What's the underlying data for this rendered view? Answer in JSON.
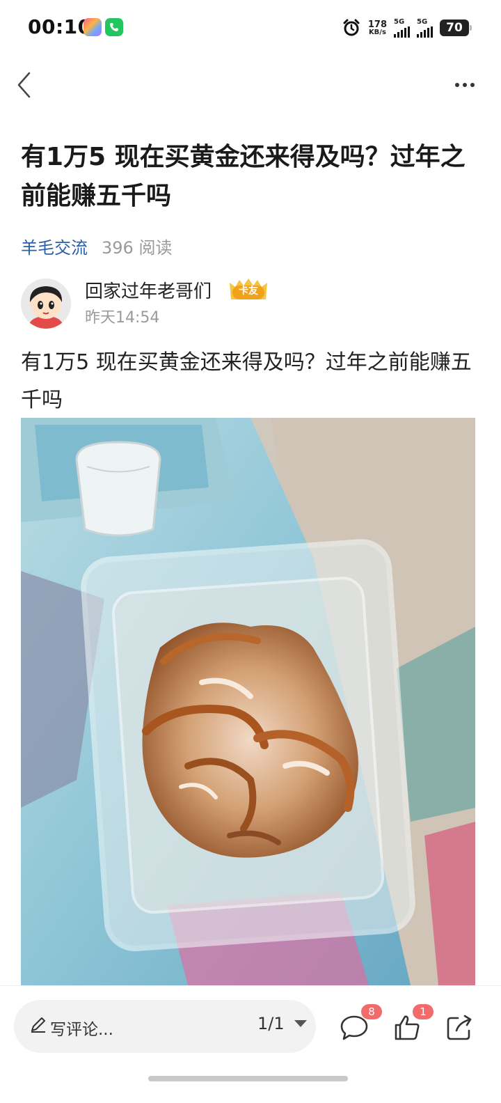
{
  "status_bar": {
    "time": "00:10",
    "net_speed_value": "178",
    "net_speed_unit": "KB/s",
    "signal1_label": "5G",
    "signal2_label": "5G",
    "battery": "70"
  },
  "post": {
    "title": "有1万5 现在买黄金还来得及吗？过年之前能赚五千吗",
    "section": "羊毛交流",
    "reads": "396 阅读",
    "author": {
      "name": "回家过年老哥们",
      "badge": "卡友",
      "time": "昨天14:54"
    },
    "body": "有1万5 现在买黄金还来得及吗？过年之前能赚五千吗"
  },
  "bottom_bar": {
    "comment_placeholder": "写评论...",
    "page_indicator": "1/1",
    "comment_count": "8",
    "like_count": "1"
  },
  "colors": {
    "section_link": "#2b5fa8",
    "badge_red": "#f26b6b",
    "muted_text": "#9a9a9a"
  }
}
